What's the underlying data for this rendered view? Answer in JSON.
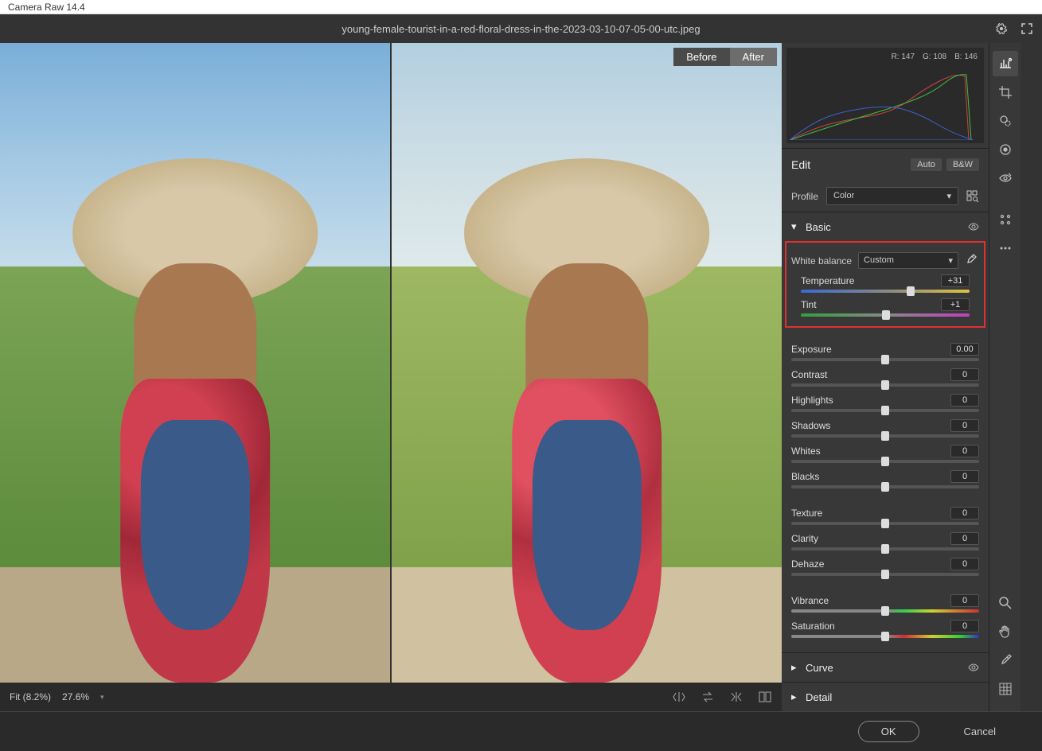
{
  "app_title": "Camera Raw 14.4",
  "filename": "young-female-tourist-in-a-red-floral-dress-in-the-2023-03-10-07-05-00-utc.jpeg",
  "compare": {
    "before": "Before",
    "after": "After"
  },
  "histogram": {
    "r_label": "R:",
    "r_val": "147",
    "g_label": "G:",
    "g_val": "108",
    "b_label": "B:",
    "b_val": "146"
  },
  "edit_header": "Edit",
  "auto_btn": "Auto",
  "bw_btn": "B&W",
  "profile_label": "Profile",
  "profile_value": "Color",
  "basic": {
    "title": "Basic",
    "wb_label": "White balance",
    "wb_value": "Custom",
    "temperature": {
      "label": "Temperature",
      "value": "+31",
      "pos": 65
    },
    "tint": {
      "label": "Tint",
      "value": "+1",
      "pos": 50.5
    },
    "exposure": {
      "label": "Exposure",
      "value": "0.00",
      "pos": 50
    },
    "contrast": {
      "label": "Contrast",
      "value": "0",
      "pos": 50
    },
    "highlights": {
      "label": "Highlights",
      "value": "0",
      "pos": 50
    },
    "shadows": {
      "label": "Shadows",
      "value": "0",
      "pos": 50
    },
    "whites": {
      "label": "Whites",
      "value": "0",
      "pos": 50
    },
    "blacks": {
      "label": "Blacks",
      "value": "0",
      "pos": 50
    },
    "texture": {
      "label": "Texture",
      "value": "0",
      "pos": 50
    },
    "clarity": {
      "label": "Clarity",
      "value": "0",
      "pos": 50
    },
    "dehaze": {
      "label": "Dehaze",
      "value": "0",
      "pos": 50
    },
    "vibrance": {
      "label": "Vibrance",
      "value": "0",
      "pos": 50
    },
    "saturation": {
      "label": "Saturation",
      "value": "0",
      "pos": 50
    }
  },
  "sections": {
    "curve": "Curve",
    "detail": "Detail"
  },
  "zoom": {
    "fit": "Fit (8.2%)",
    "level": "27.6%"
  },
  "footer": {
    "ok": "OK",
    "cancel": "Cancel"
  }
}
